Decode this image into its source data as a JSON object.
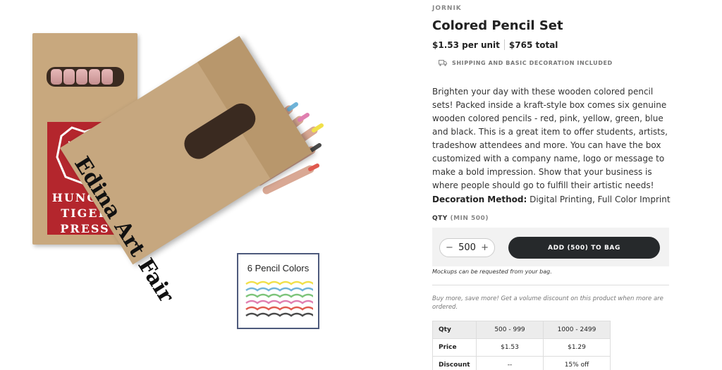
{
  "product_image": {
    "box_back_brand": "HUNGRY TIGER PRESS",
    "box_back_lines": [
      "HUNGRY",
      "TIGER",
      "PRESS"
    ],
    "box_front_imprint": "Edina Art Fair",
    "colors_card_title": "6 Pencil Colors",
    "pencil_colors": [
      "#7cc47a",
      "#6fb3d8",
      "#e07fb0",
      "#f1e04a",
      "#4a4a4a",
      "#e05a4f"
    ]
  },
  "product": {
    "brand": "JORNIK",
    "title": "Colored Pencil Set",
    "unit_price": "$1.53 per unit",
    "total_price": "$765 total",
    "shipping_note": "SHIPPING AND BASIC DECORATION INCLUDED",
    "description": "Brighten your day with these wooden colored pencil sets! Packed inside a kraft-style box comes six genuine wooden colored pencils - red, pink, yellow, green, blue and black. This is a great item to offer students, artists, tradeshow attendees and more. You can have the box customized with a company name, logo or message to make a bold impression. Show that your business is where people should go to fulfill their artistic needs!",
    "decoration_label": "Decoration Method:",
    "decoration_value": " Digital Printing, Full Color Imprint"
  },
  "order": {
    "qty_label": "QTY",
    "qty_min": "(MIN 500)",
    "qty_value": "500",
    "decrement": "−",
    "increment": "+",
    "add_button": "ADD (500) TO BAG",
    "mockup_note": "Mockups can be requested from your bag.",
    "volume_note": "Buy more, save more! Get a volume discount on this product when more are ordered."
  },
  "price_table": {
    "header": [
      "Qty",
      "500 - 999",
      "1000 - 2499"
    ],
    "rows": [
      [
        "Price",
        "$1.53",
        "$1.29"
      ],
      [
        "Discount",
        "--",
        "15% off"
      ]
    ]
  },
  "colors": {
    "button_dark": "#26292b",
    "panel_bg": "#f2f2f2",
    "kraft": "#c6a77f",
    "logo_red": "#b4262d"
  }
}
